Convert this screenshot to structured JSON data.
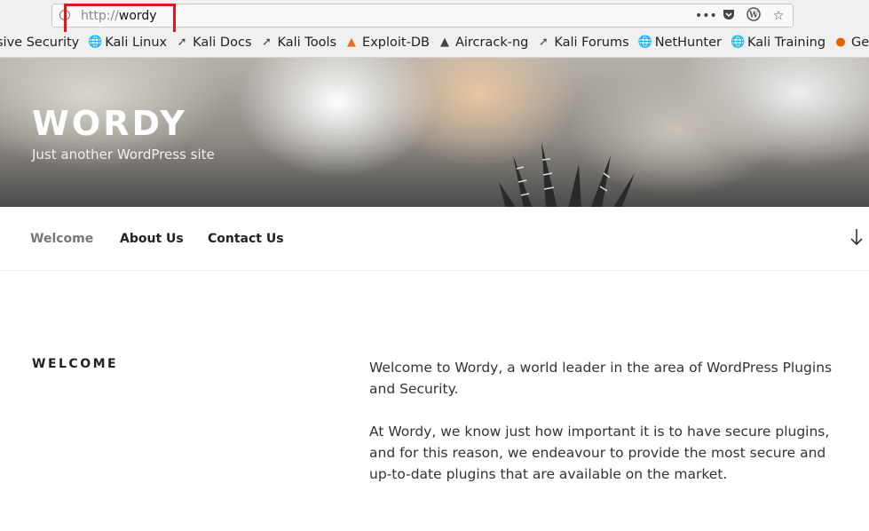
{
  "browser": {
    "url_scheme": "http://",
    "url_host": "wordy",
    "actions": [
      "page-actions",
      "pocket",
      "wordpress",
      "bookmark-star"
    ]
  },
  "bookmarks": [
    {
      "label": "sive Security",
      "icon": "offsec-icon"
    },
    {
      "label": "Kali Linux",
      "icon": "globe-icon"
    },
    {
      "label": "Kali Docs",
      "icon": "kali-icon"
    },
    {
      "label": "Kali Tools",
      "icon": "kali-icon"
    },
    {
      "label": "Exploit-DB",
      "icon": "exploitdb-icon"
    },
    {
      "label": "Aircrack-ng",
      "icon": "aircrack-icon"
    },
    {
      "label": "Kali Forums",
      "icon": "kali-icon"
    },
    {
      "label": "NetHunter",
      "icon": "globe-icon"
    },
    {
      "label": "Kali Training",
      "icon": "globe-icon"
    },
    {
      "label": "Gettin",
      "icon": "firefox-icon"
    }
  ],
  "site": {
    "title": "WORDY",
    "tagline": "Just another WordPress site"
  },
  "nav": {
    "items": [
      {
        "label": "Welcome",
        "current": true
      },
      {
        "label": "About Us",
        "current": false
      },
      {
        "label": "Contact Us",
        "current": false
      }
    ]
  },
  "content": {
    "heading": "WELCOME",
    "paragraphs": [
      "Welcome to Wordy, a world leader in the area of WordPress Plugins and Security.",
      "At Wordy, we know just how important it is to have secure plugins, and for this reason, we endeavour to provide the most secure and up-to-date plugins that are available on the market."
    ]
  },
  "colors": {
    "highlight_box": "#e8141d",
    "text": "#333333",
    "nav_current": "#767676"
  }
}
